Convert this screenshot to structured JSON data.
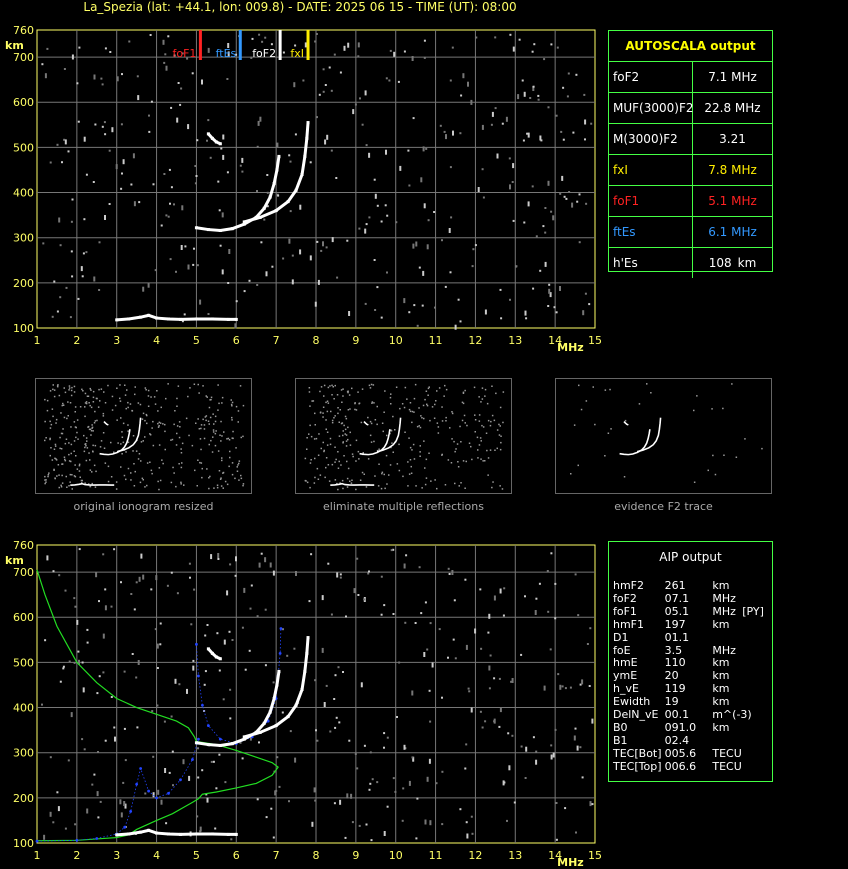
{
  "header": {
    "title": "La_Spezia (lat: +44.1, lon: 009.8) - DATE: 2025 06 15 - TIME (UT): 08:00"
  },
  "chart_data": [
    {
      "id": "main-ionogram",
      "type": "scatter",
      "xlabel": "MHz",
      "ylabel": "km",
      "xlim": [
        1,
        15
      ],
      "ylim": [
        100,
        760
      ],
      "xticks": [
        1,
        2,
        3,
        4,
        5,
        6,
        7,
        8,
        9,
        10,
        11,
        12,
        13,
        14,
        15
      ],
      "yticks": [
        100,
        200,
        300,
        400,
        500,
        600,
        700,
        760
      ],
      "grid": true,
      "markers": [
        {
          "label": "foF1",
          "x": 5.1,
          "color": "#ff2222"
        },
        {
          "label": "ftEs",
          "x": 6.1,
          "color": "#3399ff"
        },
        {
          "label": "foF2",
          "x": 7.1,
          "color": "#ffffff"
        },
        {
          "label": "fxI",
          "x": 7.8,
          "color": "#ffee00"
        }
      ],
      "traces": [
        {
          "name": "E-trace",
          "points": [
            [
              3.0,
              118
            ],
            [
              3.3,
              120
            ],
            [
              3.6,
              124
            ],
            [
              3.8,
              128
            ],
            [
              4.0,
              122
            ],
            [
              4.3,
              120
            ],
            [
              4.6,
              119
            ],
            [
              5.0,
              120
            ],
            [
              5.4,
              120
            ],
            [
              5.8,
              119
            ],
            [
              6.0,
              119
            ]
          ]
        },
        {
          "name": "F-ordinary",
          "points": [
            [
              5.0,
              322
            ],
            [
              5.3,
              318
            ],
            [
              5.6,
              316
            ],
            [
              5.9,
              320
            ],
            [
              6.2,
              330
            ],
            [
              6.5,
              345
            ],
            [
              6.7,
              365
            ],
            [
              6.85,
              390
            ],
            [
              6.95,
              420
            ],
            [
              7.02,
              450
            ],
            [
              7.07,
              480
            ]
          ]
        },
        {
          "name": "F-extraordinary",
          "points": [
            [
              6.2,
              335
            ],
            [
              6.6,
              345
            ],
            [
              7.0,
              360
            ],
            [
              7.3,
              380
            ],
            [
              7.5,
              405
            ],
            [
              7.65,
              440
            ],
            [
              7.72,
              480
            ],
            [
              7.77,
              520
            ],
            [
              7.8,
              555
            ]
          ]
        },
        {
          "name": "F-isolated",
          "points": [
            [
              5.3,
              530
            ],
            [
              5.4,
              520
            ],
            [
              5.5,
              512
            ],
            [
              5.6,
              508
            ]
          ]
        }
      ]
    },
    {
      "id": "aip-ionogram",
      "type": "line",
      "xlabel": "MHz",
      "ylabel": "km",
      "xlim": [
        1,
        15
      ],
      "ylim": [
        100,
        760
      ],
      "xticks": [
        1,
        2,
        3,
        4,
        5,
        6,
        7,
        8,
        9,
        10,
        11,
        12,
        13,
        14,
        15
      ],
      "yticks": [
        100,
        200,
        300,
        400,
        500,
        600,
        700,
        760
      ],
      "grid": true,
      "traces": [
        {
          "name": "E-trace",
          "points": [
            [
              3.0,
              118
            ],
            [
              3.3,
              120
            ],
            [
              3.6,
              124
            ],
            [
              3.8,
              128
            ],
            [
              4.0,
              122
            ],
            [
              4.3,
              120
            ],
            [
              4.6,
              119
            ],
            [
              5.0,
              120
            ],
            [
              5.4,
              120
            ],
            [
              5.8,
              119
            ],
            [
              6.0,
              119
            ]
          ]
        },
        {
          "name": "F-ordinary",
          "points": [
            [
              5.0,
              322
            ],
            [
              5.3,
              318
            ],
            [
              5.6,
              316
            ],
            [
              5.9,
              320
            ],
            [
              6.2,
              330
            ],
            [
              6.5,
              345
            ],
            [
              6.7,
              365
            ],
            [
              6.85,
              390
            ],
            [
              6.95,
              420
            ],
            [
              7.02,
              450
            ],
            [
              7.07,
              480
            ]
          ]
        },
        {
          "name": "F-extraordinary",
          "points": [
            [
              6.2,
              335
            ],
            [
              6.6,
              345
            ],
            [
              7.0,
              360
            ],
            [
              7.3,
              380
            ],
            [
              7.5,
              405
            ],
            [
              7.65,
              440
            ],
            [
              7.72,
              480
            ],
            [
              7.77,
              520
            ],
            [
              7.8,
              555
            ]
          ]
        },
        {
          "name": "F-isolated",
          "points": [
            [
              5.3,
              530
            ],
            [
              5.4,
              520
            ],
            [
              5.5,
              512
            ],
            [
              5.6,
              508
            ]
          ]
        }
      ],
      "profile_green": [
        [
          1.0,
          705
        ],
        [
          1.2,
          650
        ],
        [
          1.5,
          580
        ],
        [
          2.0,
          500
        ],
        [
          2.5,
          455
        ],
        [
          3.0,
          420
        ],
        [
          3.5,
          400
        ],
        [
          4.0,
          385
        ],
        [
          4.5,
          370
        ],
        [
          4.8,
          355
        ],
        [
          4.95,
          335
        ],
        [
          5.0,
          325
        ],
        [
          5.5,
          318
        ],
        [
          6.0,
          305
        ],
        [
          6.5,
          290
        ],
        [
          6.9,
          278
        ],
        [
          7.05,
          268
        ],
        [
          6.9,
          250
        ],
        [
          6.5,
          232
        ],
        [
          6.0,
          222
        ],
        [
          5.5,
          213
        ],
        [
          5.15,
          208
        ],
        [
          5.05,
          198
        ],
        [
          4.9,
          190
        ],
        [
          4.7,
          180
        ],
        [
          4.4,
          165
        ],
        [
          4.0,
          150
        ],
        [
          3.7,
          138
        ],
        [
          3.5,
          130
        ],
        [
          3.3,
          118
        ],
        [
          3.0,
          112
        ],
        [
          2.0,
          106
        ],
        [
          1.0,
          105
        ]
      ],
      "profile_blue_low": [
        [
          1.0,
          104
        ],
        [
          2.0,
          106
        ],
        [
          2.5,
          110
        ],
        [
          3.0,
          120
        ],
        [
          3.2,
          135
        ],
        [
          3.35,
          170
        ],
        [
          3.5,
          230
        ],
        [
          3.6,
          265
        ],
        [
          3.8,
          215
        ],
        [
          4.0,
          200
        ],
        [
          4.3,
          210
        ],
        [
          4.6,
          240
        ],
        [
          4.9,
          285
        ],
        [
          5.05,
          330
        ]
      ],
      "profile_blue_high": [
        [
          5.0,
          540
        ],
        [
          5.05,
          470
        ],
        [
          5.15,
          405
        ],
        [
          5.3,
          360
        ],
        [
          5.6,
          330
        ],
        [
          6.0,
          320
        ],
        [
          6.4,
          335
        ],
        [
          6.8,
          370
        ],
        [
          7.0,
          420
        ],
        [
          7.05,
          470
        ],
        [
          7.1,
          520
        ],
        [
          7.12,
          575
        ]
      ]
    }
  ],
  "autoscala": {
    "title": "AUTOSCALA output",
    "rows": [
      {
        "label": "foF2",
        "value": "7.1 MHz",
        "color": "#ffffff"
      },
      {
        "label": "MUF(3000)F2",
        "value": "22.8 MHz",
        "color": "#ffffff"
      },
      {
        "label": "M(3000)F2",
        "value": "3.21",
        "color": "#ffffff"
      },
      {
        "label": "fxI",
        "value": "7.8 MHz",
        "color": "#ffee00"
      },
      {
        "label": "foF1",
        "value": "5.1 MHz",
        "color": "#ff2222"
      },
      {
        "label": "ftEs",
        "value": "6.1 MHz",
        "color": "#3399ff"
      },
      {
        "label": "h'Es",
        "value": "108",
        "unit": "km",
        "color": "#ffffff"
      }
    ]
  },
  "thumbnails": [
    {
      "caption": "original ionogram resized"
    },
    {
      "caption": "eliminate multiple reflections"
    },
    {
      "caption": "evidence F2 trace"
    }
  ],
  "aip": {
    "title": "AIP output",
    "rows": [
      [
        "hmF2",
        "261",
        "km",
        ""
      ],
      [
        "foF2",
        "07.1",
        "MHz",
        ""
      ],
      [
        "foF1",
        "05.1",
        "MHz",
        "[PY]"
      ],
      [
        "hmF1",
        "197",
        "km",
        ""
      ],
      [
        "D1",
        "01.1",
        "",
        ""
      ],
      [
        "foE",
        "3.5",
        "MHz",
        ""
      ],
      [
        "hmE",
        "110",
        "km",
        ""
      ],
      [
        "ymE",
        "20",
        "km",
        ""
      ],
      [
        "h_vE",
        "119",
        "km",
        ""
      ],
      [
        "Ewidth",
        "19",
        "km",
        ""
      ],
      [
        "DelN_vE",
        "00.1",
        "m^(-3)",
        ""
      ],
      [
        "B0",
        "091.0",
        "km",
        ""
      ],
      [
        "B1",
        "02.4",
        "",
        ""
      ],
      [
        "TEC[Bot]",
        "005.6",
        "TECU",
        ""
      ],
      [
        "TEC[Top]",
        "006.6",
        "TECU",
        ""
      ]
    ]
  }
}
